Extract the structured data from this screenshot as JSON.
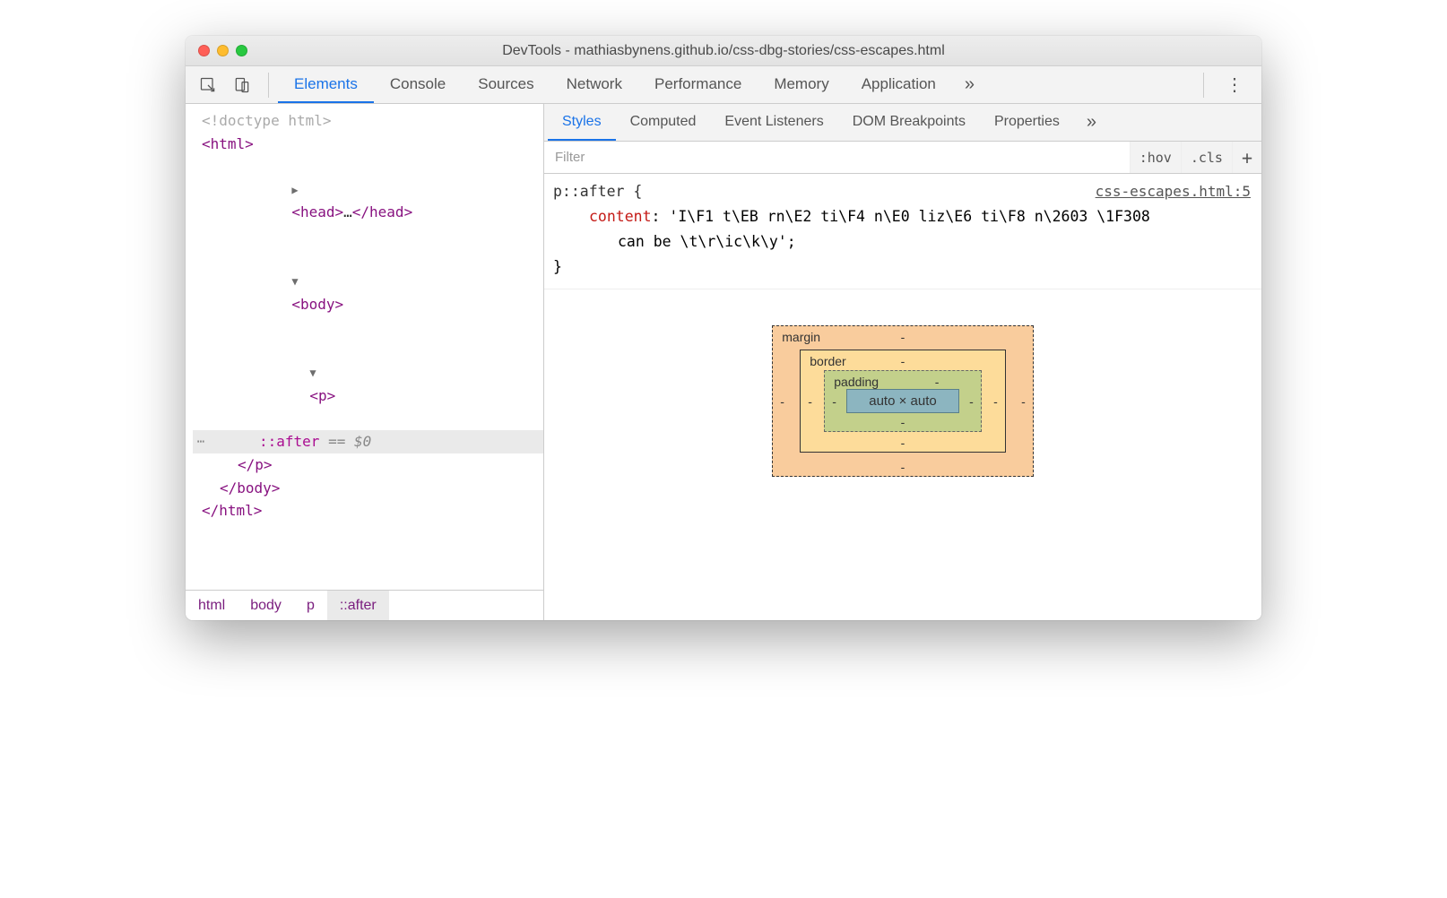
{
  "window": {
    "title": "DevTools - mathiasbynens.github.io/css-dbg-stories/css-escapes.html"
  },
  "mainTabs": {
    "items": [
      "Elements",
      "Console",
      "Sources",
      "Network",
      "Performance",
      "Memory",
      "Application"
    ],
    "more": "»"
  },
  "dom": {
    "line0": "<!doctype html>",
    "line1": "<html>",
    "line2_open": "<head>",
    "line2_ellip": "…",
    "line2_close": "</head>",
    "line3": "<body>",
    "line4": "<p>",
    "line5_pseudo": "::after",
    "line5_eq": " == $0",
    "line6": "</p>",
    "line7": "</body>",
    "line8": "</html>"
  },
  "breadcrumb": {
    "items": [
      "html",
      "body",
      "p",
      "::after"
    ]
  },
  "subTabs": {
    "items": [
      "Styles",
      "Computed",
      "Event Listeners",
      "DOM Breakpoints",
      "Properties"
    ],
    "more": "»"
  },
  "filter": {
    "placeholder": "Filter",
    "hov": ":hov",
    "cls": ".cls",
    "add": "+"
  },
  "rule": {
    "selector": "p::after {",
    "source": "css-escapes.html:5",
    "propName": "content",
    "propValue1": "'I\\F1 t\\EB rn\\E2 ti\\F4 n\\E0 liz\\E6 ti\\F8 n\\2603 \\1F308",
    "propValue2": "can be \\t\\r\\ic\\k\\y';",
    "close": "}"
  },
  "boxModel": {
    "marginLabel": "margin",
    "borderLabel": "border",
    "paddingLabel": "padding",
    "content": "auto × auto",
    "dash": "-"
  }
}
